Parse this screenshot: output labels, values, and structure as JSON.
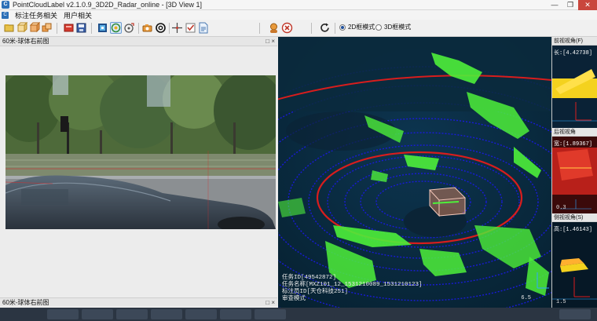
{
  "window": {
    "title": "PointCloudLabel v2.1.0.9_3D2D_Radar_online - [3D View 1]",
    "app_icon": "C",
    "minimize": "—",
    "maximize": "❐",
    "close": "✕"
  },
  "menu": {
    "icon": "C",
    "items": [
      "标注任务相关",
      "用户相关"
    ]
  },
  "toolbar": {
    "radio_2d": "2D框模式",
    "radio_3d": "3D框模式",
    "selected_mode": "2D框模式"
  },
  "left_panel": {
    "header_title": "60米-球体右前图",
    "footer_title": "60米-球体右前图",
    "pin": "□",
    "close": "×"
  },
  "view3d": {
    "task_id": "任务ID[49542872]",
    "task_name": "任务名称[MXZ101_12_1531210089_1531210123]",
    "annotator_id": "标注员ID[天仓科技251]",
    "mode": "审查模式",
    "scale_value": "6.5",
    "colors": {
      "background": "#0a2a3d",
      "points_ground": "#1a1ae0",
      "points_objects": "#4ef03a",
      "rings": "#d81d1d"
    }
  },
  "right_panels": {
    "front": {
      "title": "前视视角(F)",
      "value_label": "长:[4.42738]"
    },
    "back": {
      "title": "后视视角",
      "value_label": "宽:[1.89367]",
      "bottom_value": "0.3"
    },
    "side": {
      "title": "侧视视角(S)",
      "value_label": "高:[1.46143]",
      "bottom_value": "1.5"
    }
  }
}
